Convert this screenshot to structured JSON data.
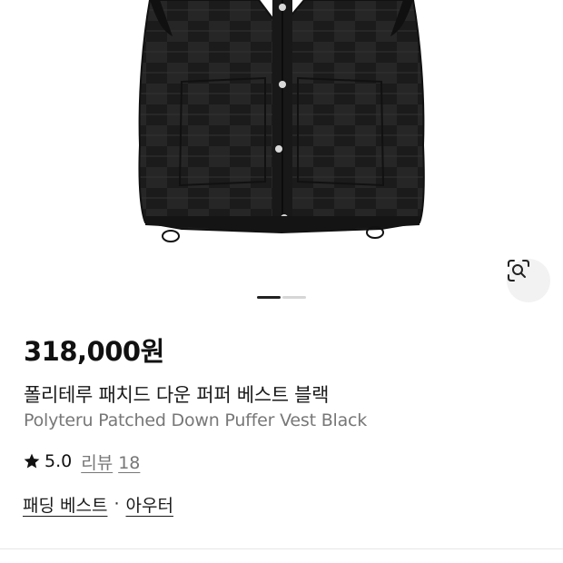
{
  "product": {
    "price": "318,000원",
    "name_ko": "폴리테루 패치드 다운 퍼퍼 베스트 블랙",
    "name_en": "Polyteru Patched Down Puffer Vest Black",
    "rating": "5.0",
    "review_label": "리뷰",
    "review_count": "18",
    "categories": [
      "패딩 베스트",
      "아우터"
    ],
    "category_separator": "·"
  },
  "gallery": {
    "image_alt": "black patched down puffer vest",
    "slide_count": 2,
    "active_slide": 1,
    "visual_search_icon": "lens-search-icon"
  },
  "colors": {
    "vest": "#1e1e1e",
    "active_dot": "#222222",
    "inactive_dot": "#d6d6d6",
    "secondary_text": "#777777"
  }
}
